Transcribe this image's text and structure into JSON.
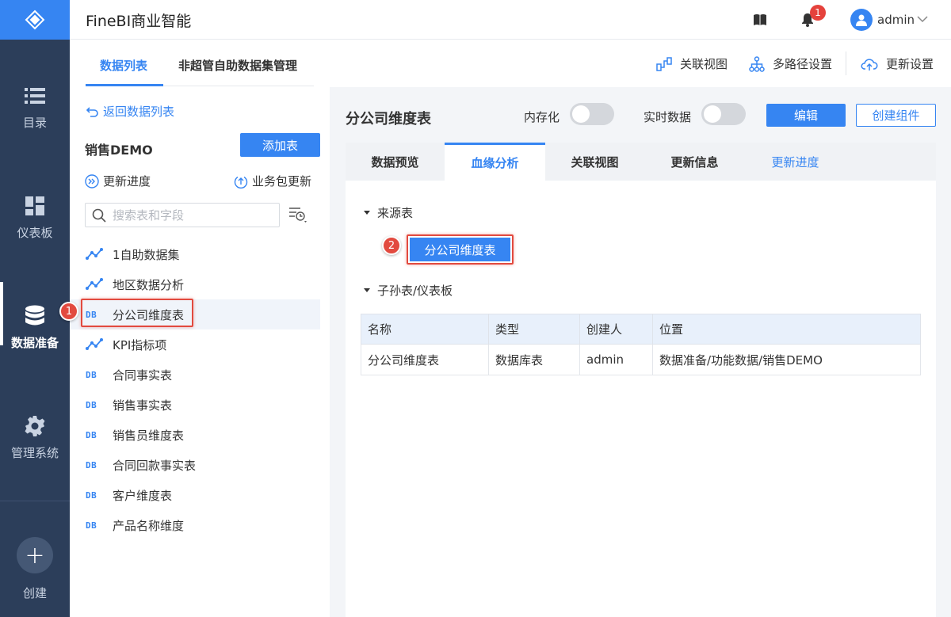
{
  "app": {
    "title": "FineBI商业智能"
  },
  "topbar": {
    "notification_count": "1",
    "user": "admin"
  },
  "nav": {
    "items": [
      {
        "label": "目录",
        "icon": "list-icon"
      },
      {
        "label": "仪表板",
        "icon": "dashboard-icon"
      },
      {
        "label": "数据准备",
        "icon": "database-icon",
        "active": true
      },
      {
        "label": "管理系统",
        "icon": "gear-icon"
      }
    ],
    "create": {
      "label": "创建",
      "symbol": "+"
    }
  },
  "subbar": {
    "tabs": [
      {
        "label": "数据列表",
        "active": true
      },
      {
        "label": "非超管自助数据集管理"
      }
    ],
    "actions": [
      {
        "label": "关联视图",
        "icon": "relation-view-icon"
      },
      {
        "label": "多路径设置",
        "icon": "multipath-icon"
      },
      {
        "label": "更新设置",
        "icon": "cloud-update-icon"
      }
    ]
  },
  "left": {
    "back_label": "返回数据列表",
    "package_name": "销售DEMO",
    "add_table_label": "添加表",
    "update_progress_label": "更新进度",
    "package_update_label": "业务包更新",
    "search_placeholder": "搜索表和字段",
    "db_tag": "DB",
    "tables": [
      {
        "name": "1自助数据集",
        "type": "self"
      },
      {
        "name": "地区数据分析",
        "type": "self"
      },
      {
        "name": "分公司维度表",
        "type": "db",
        "selected": true
      },
      {
        "name": "KPI指标项",
        "type": "self"
      },
      {
        "name": "合同事实表",
        "type": "db"
      },
      {
        "name": "销售事实表",
        "type": "db"
      },
      {
        "name": "销售员维度表",
        "type": "db"
      },
      {
        "name": "合同回款事实表",
        "type": "db"
      },
      {
        "name": "客户维度表",
        "type": "db"
      },
      {
        "name": "产品名称维度",
        "type": "db"
      }
    ]
  },
  "annotations": {
    "step1": "1",
    "step2": "2"
  },
  "main": {
    "title": "分公司维度表",
    "in_memory_label": "内存化",
    "in_memory_on": false,
    "realtime_label": "实时数据",
    "realtime_on": false,
    "edit_label": "编辑",
    "create_component_label": "创建组件",
    "tabs": [
      {
        "label": "数据预览"
      },
      {
        "label": "血缘分析",
        "active": true
      },
      {
        "label": "关联视图"
      },
      {
        "label": "更新信息"
      },
      {
        "label": "更新进度",
        "link": true
      }
    ],
    "source_section": "来源表",
    "source_table": "分公司维度表",
    "children_section": "子孙表/仪表板",
    "table": {
      "headers": [
        "名称",
        "类型",
        "创建人",
        "位置"
      ],
      "rows": [
        [
          "分公司维度表",
          "数据库表",
          "admin",
          "数据准备/功能数据/销售DEMO"
        ]
      ]
    }
  },
  "colors": {
    "accent": "#3685f2",
    "nav_bg": "#2c3e5a",
    "highlight": "#e24a3f"
  }
}
